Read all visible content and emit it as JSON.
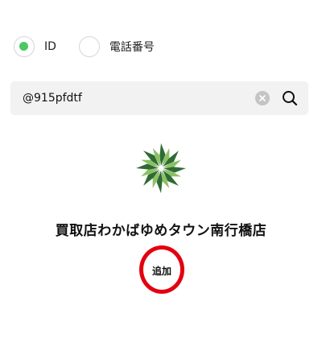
{
  "search_type": {
    "options": [
      {
        "label": "ID",
        "selected": true
      },
      {
        "label": "電話番号",
        "selected": false
      }
    ]
  },
  "search": {
    "value": "@915pfdtf",
    "clear_icon": "clear-circle-icon",
    "search_icon": "magnifier-icon"
  },
  "result": {
    "logo_icon": "green-starburst-logo",
    "name": "買取店わかばゆめタウン南行橋店",
    "add_label": "追加"
  },
  "colors": {
    "radio_selected": "#4cc764",
    "highlight_circle": "#e3000f",
    "logo_dark_green": "#2e6b34",
    "logo_light_green": "#8cc063"
  }
}
